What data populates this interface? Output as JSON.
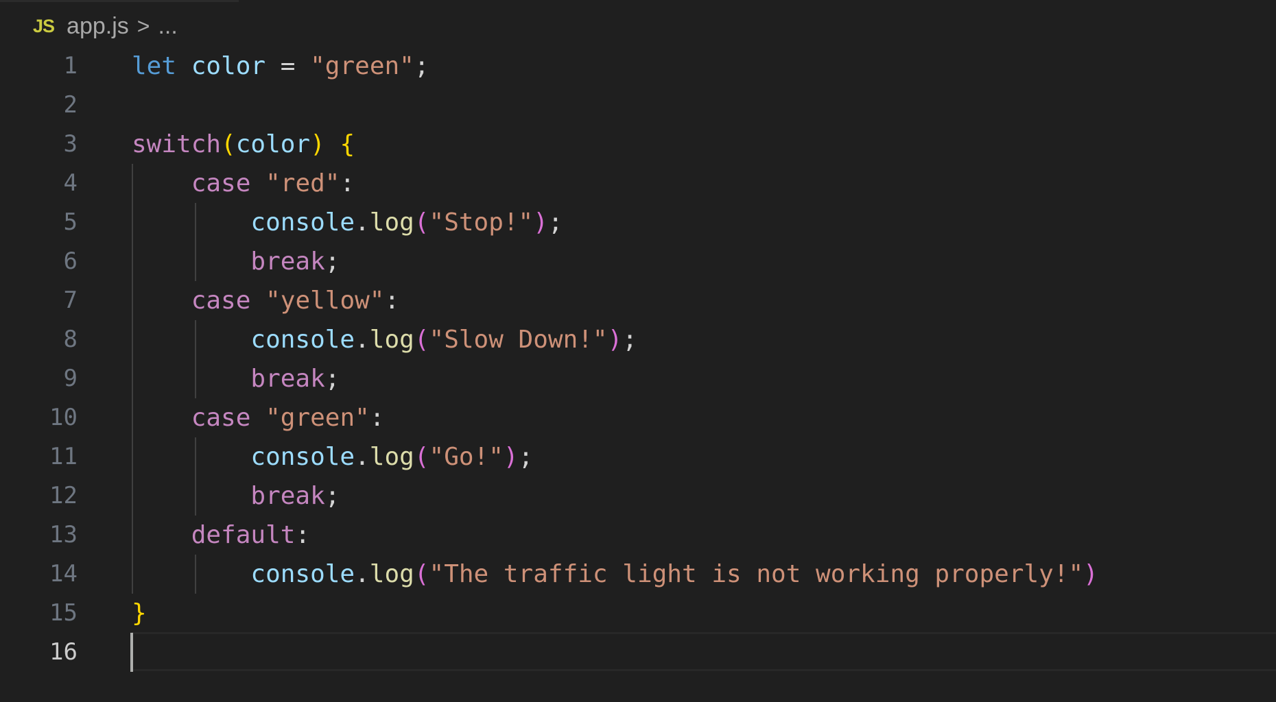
{
  "breadcrumb": {
    "file_icon": "js-file-icon",
    "file_icon_text": "JS",
    "file": "app.js",
    "separator": ">",
    "symbol": "..."
  },
  "colors": {
    "background": "#1f1f1f",
    "keyword": "#569cd6",
    "control": "#c586c0",
    "variable": "#9cdcfe",
    "string": "#ce9178",
    "function": "#dcdcaa",
    "bracket1": "#ffd700",
    "bracket2": "#da70d6",
    "plain": "#d4d4d4"
  },
  "editor": {
    "active_line": 16,
    "lines": [
      {
        "n": "1",
        "tokens": [
          [
            "let",
            "keyword"
          ],
          [
            " ",
            "plain"
          ],
          [
            "color",
            "variable"
          ],
          [
            " = ",
            "plain"
          ],
          [
            "\"green\"",
            "string"
          ],
          [
            ";",
            "plain"
          ]
        ]
      },
      {
        "n": "2",
        "tokens": []
      },
      {
        "n": "3",
        "tokens": [
          [
            "switch",
            "control"
          ],
          [
            "(",
            "bracket1"
          ],
          [
            "color",
            "variable"
          ],
          [
            ")",
            "bracket1"
          ],
          [
            " ",
            "plain"
          ],
          [
            "{",
            "bracket1"
          ]
        ]
      },
      {
        "n": "4",
        "tokens": [
          [
            "    ",
            "plain"
          ],
          [
            "case",
            "control"
          ],
          [
            " ",
            "plain"
          ],
          [
            "\"red\"",
            "string"
          ],
          [
            ":",
            "plain"
          ]
        ]
      },
      {
        "n": "5",
        "tokens": [
          [
            "        ",
            "plain"
          ],
          [
            "console",
            "variable"
          ],
          [
            ".",
            "plain"
          ],
          [
            "log",
            "function"
          ],
          [
            "(",
            "bracket2"
          ],
          [
            "\"Stop!\"",
            "string"
          ],
          [
            ")",
            "bracket2"
          ],
          [
            ";",
            "plain"
          ]
        ]
      },
      {
        "n": "6",
        "tokens": [
          [
            "        ",
            "plain"
          ],
          [
            "break",
            "control"
          ],
          [
            ";",
            "plain"
          ]
        ]
      },
      {
        "n": "7",
        "tokens": [
          [
            "    ",
            "plain"
          ],
          [
            "case",
            "control"
          ],
          [
            " ",
            "plain"
          ],
          [
            "\"yellow\"",
            "string"
          ],
          [
            ":",
            "plain"
          ]
        ]
      },
      {
        "n": "8",
        "tokens": [
          [
            "        ",
            "plain"
          ],
          [
            "console",
            "variable"
          ],
          [
            ".",
            "plain"
          ],
          [
            "log",
            "function"
          ],
          [
            "(",
            "bracket2"
          ],
          [
            "\"Slow Down!\"",
            "string"
          ],
          [
            ")",
            "bracket2"
          ],
          [
            ";",
            "plain"
          ]
        ]
      },
      {
        "n": "9",
        "tokens": [
          [
            "        ",
            "plain"
          ],
          [
            "break",
            "control"
          ],
          [
            ";",
            "plain"
          ]
        ]
      },
      {
        "n": "10",
        "tokens": [
          [
            "    ",
            "plain"
          ],
          [
            "case",
            "control"
          ],
          [
            " ",
            "plain"
          ],
          [
            "\"green\"",
            "string"
          ],
          [
            ":",
            "plain"
          ]
        ]
      },
      {
        "n": "11",
        "tokens": [
          [
            "        ",
            "plain"
          ],
          [
            "console",
            "variable"
          ],
          [
            ".",
            "plain"
          ],
          [
            "log",
            "function"
          ],
          [
            "(",
            "bracket2"
          ],
          [
            "\"Go!\"",
            "string"
          ],
          [
            ")",
            "bracket2"
          ],
          [
            ";",
            "plain"
          ]
        ]
      },
      {
        "n": "12",
        "tokens": [
          [
            "        ",
            "plain"
          ],
          [
            "break",
            "control"
          ],
          [
            ";",
            "plain"
          ]
        ]
      },
      {
        "n": "13",
        "tokens": [
          [
            "    ",
            "plain"
          ],
          [
            "default",
            "control"
          ],
          [
            ":",
            "plain"
          ]
        ]
      },
      {
        "n": "14",
        "tokens": [
          [
            "        ",
            "plain"
          ],
          [
            "console",
            "variable"
          ],
          [
            ".",
            "plain"
          ],
          [
            "log",
            "function"
          ],
          [
            "(",
            "bracket2"
          ],
          [
            "\"The traffic light is not working properly!\"",
            "string"
          ],
          [
            ")",
            "bracket2"
          ]
        ]
      },
      {
        "n": "15",
        "tokens": [
          [
            "}",
            "bracket1"
          ]
        ]
      },
      {
        "n": "16",
        "tokens": []
      }
    ]
  }
}
